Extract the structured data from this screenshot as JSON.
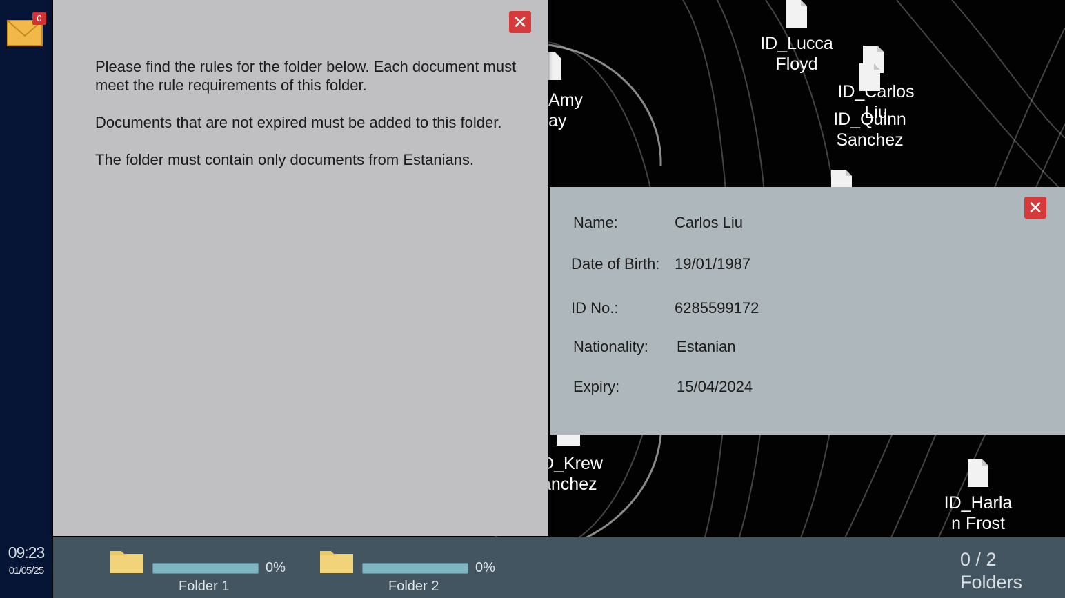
{
  "sidebar": {
    "mail_unread": "0",
    "clock_time": "09:23",
    "clock_date": "01/05/25"
  },
  "desktop_files": [
    {
      "name": "ID_Lucca Floyd",
      "lines": [
        "ID_Lucca",
        "Floyd"
      ]
    },
    {
      "name": "ID_Carlos Liu",
      "lines": [
        "ID_Carlos",
        "Liu"
      ]
    },
    {
      "name": "ID_Quinn Sanchez",
      "lines": [
        "ID_Quinn",
        "Sanchez"
      ]
    },
    {
      "name": "ID_Amy ...ay",
      "lines": [
        "Amy",
        "ay"
      ]
    },
    {
      "name": "ID_Krew Sanchez",
      "lines": [
        "D_Krew",
        "anchez"
      ]
    },
    {
      "name": "ID_Harlan Frost",
      "lines": [
        "ID_Harla",
        "n Frost"
      ]
    }
  ],
  "rules_window": {
    "close_label": "✕",
    "paragraphs": [
      "Please find the rules for the folder below. Each document must meet the rule requirements of this folder.",
      "Documents that are not expired must be added to this folder.",
      "The folder must contain only documents from Estanians."
    ]
  },
  "id_card": {
    "close_label": "✕",
    "fields": {
      "name_label": "Name:",
      "name_value": "Carlos Liu",
      "dob_label": "Date of Birth:",
      "dob_value": "19/01/1987",
      "id_label": "ID No.:",
      "id_value": "6285599172",
      "nat_label": "Nationality:",
      "nat_value": "Estanian",
      "exp_label": "Expiry:",
      "exp_value": "15/04/2024"
    }
  },
  "taskbar": {
    "folders": [
      {
        "name": "Folder 1",
        "progress_label": "0%",
        "progress": 0
      },
      {
        "name": "Folder 2",
        "progress_label": "0%",
        "progress": 0
      }
    ],
    "folder_count": "0 / 2",
    "folder_count_label": "Folders"
  },
  "colors": {
    "sidebar": "#061535",
    "taskbar": "#435561",
    "rules_bg": "#c0c0c2",
    "card_bg": "#aeb8bc",
    "close_red": "#d63a3a",
    "folder_yellow": "#f0cd6c"
  },
  "icons": {
    "mail": "envelope-icon",
    "file": "document-icon",
    "folder": "folder-icon",
    "close": "close-icon"
  }
}
